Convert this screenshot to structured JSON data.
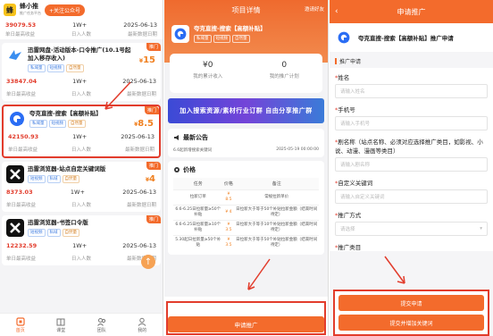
{
  "panel1": {
    "brand": "蜂小推",
    "brand_sub": "推广任务平台",
    "follow": "+关注公众号",
    "top_stats": {
      "values": [
        "39079.53",
        "1W+",
        "2025-06-13"
      ],
      "labels": [
        "单日最高收益",
        "日入人数",
        "最新数据日期"
      ]
    },
    "cards": [
      {
        "title": "迅雷网盘-活动版本-口令推广(10.1号起加入移存收入)",
        "tags": [
          "私域量",
          "短视频",
          "自然量"
        ],
        "price": "15",
        "badge": "推门",
        "stats": [
          "33847.04",
          "1W+",
          "2025-06-13"
        ],
        "labels": [
          "单日最高收益",
          "日入人数",
          "最新数据日期"
        ]
      },
      {
        "title": "夸克直搜-搜索【高额补贴】",
        "tags": [
          "私域量",
          "短视频",
          "自然量"
        ],
        "price": "8.5",
        "badge": "推门",
        "stats": [
          "42150.93",
          "1W+",
          "2025-06-13"
        ],
        "labels": [
          "单日最高收益",
          "日入人数",
          "最新数据日期"
        ]
      },
      {
        "title": "迅雷浏览器-站点自定关键词版",
        "tags": [
          "短视频",
          "私域",
          "自然量"
        ],
        "price": "4",
        "badge": "推门",
        "stats": [
          "8373.03",
          "1W+",
          "2025-06-13"
        ],
        "labels": [
          "单日最高收益",
          "日入人数",
          "最新数据日期"
        ]
      },
      {
        "title": "迅雷浏览器-书签口令版",
        "tags": [
          "短视频",
          "私域",
          "自然量"
        ],
        "price": "",
        "badge": "推门",
        "stats": [
          "12232.59",
          "1W+",
          "2025-06-13"
        ],
        "labels": [
          "单日最高收益",
          "日入人数",
          "最新数据日期"
        ]
      }
    ],
    "float_icon": "↑",
    "nav": [
      "首页",
      "课堂",
      "团队",
      "我的"
    ]
  },
  "panel2": {
    "title": "项目详情",
    "invite": "邀请好友",
    "product": "夸克直搜-搜索【高额补贴】",
    "tags": [
      "私域量",
      "短视频",
      "自然量"
    ],
    "stats": [
      {
        "num": "¥0",
        "label": "我的累计收入"
      },
      {
        "num": "0",
        "label": "我的推广计划"
      }
    ],
    "banner": "加入搜索资源/素材行业订群 自由分享推广群",
    "notice_title": "最新公告",
    "notice_text": "6.6起新增搜索关键词",
    "notice_date": "2025-05-19 00:00:00",
    "price_title": "价格",
    "table_headers": [
      "任务",
      "价格",
      "备注"
    ],
    "table_rows": [
      [
        "拉新订单",
        "¥ 8.5",
        "常规拉新单价"
      ],
      [
        "6.6-6.25日拉新量≥50个补贴",
        "¥ 4",
        "日拉新大于等于50个补贴拉新金额（结束时间待定）"
      ],
      [
        "6.6-6.25日拉新量≥10个补贴",
        "¥ 3.5",
        "日拉新大于等于10个补贴拉新金额（结束时间待定）"
      ],
      [
        "5.30起日拉新量≥50个补贴",
        "¥ 3.5",
        "日拉新大于等于50个补贴拉新金额（结束时间待定）"
      ]
    ],
    "apply": "申请推广"
  },
  "panel3": {
    "title": "申请推广",
    "back": "‹",
    "product": "夸克直搜-搜索【高额补贴】推广申请",
    "section": "推广申请",
    "fields": [
      {
        "label": "姓名",
        "placeholder": "请输入姓名"
      },
      {
        "label": "手机号",
        "placeholder": "请输入手机号"
      },
      {
        "label": "剧名称（站点名称、必须对应选择推广类目，如影视、小说、动漫、漫画等类目）",
        "placeholder": "请输入剧名称"
      },
      {
        "label": "自定义关键词",
        "placeholder": "请输入自定义关键词"
      },
      {
        "label": "推广方式",
        "placeholder": "请选择"
      },
      {
        "label": "推广类目",
        "placeholder": "请选择"
      }
    ],
    "submit": "提交申请",
    "submit_more": "提交并增加关键词"
  },
  "colors": {
    "accent": "#f36b2c",
    "highlight": "#e23c2c",
    "price": "#f08020"
  }
}
